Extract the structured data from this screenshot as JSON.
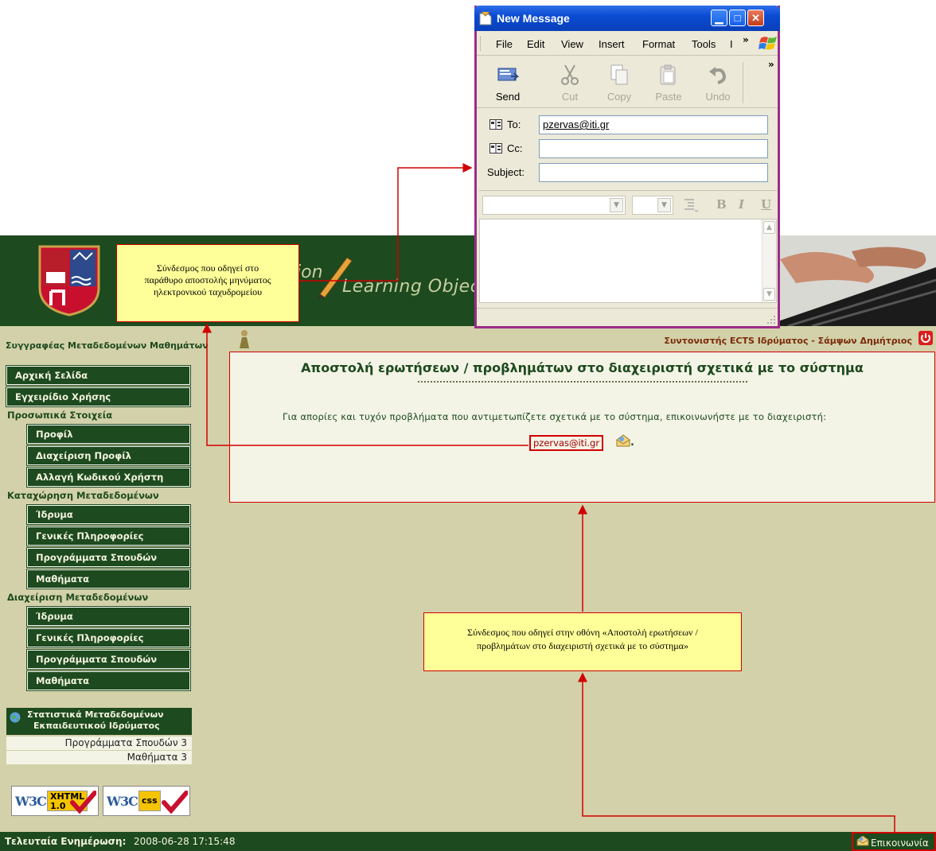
{
  "app": {
    "header_title_fragment": "ion",
    "header_subtitle": "Learning Objec",
    "author_role": "Συγγραφέας Μεταδεδομένων Μαθημάτων",
    "coordinator": "Συντονιστής ECTS Ιδρύματος - Σάμψων Δημήτριος"
  },
  "sidebar": {
    "home": "Αρχική Σελίδα",
    "manual": "Εγχειρίδιο Χρήσης",
    "personal_header": "Προσωπικά Στοιχεία",
    "profile": "Προφίλ",
    "profile_manage": "Διαχείριση Προφίλ",
    "change_password": "Αλλαγή Κωδικού Χρήστη",
    "registration_header": "Καταχώρηση Μεταδεδομένων",
    "reg_institution": "Ίδρυμα",
    "reg_general": "Γενικές Πληροφορίες",
    "reg_programs": "Προγράμματα Σπουδών",
    "reg_courses": "Μαθήματα",
    "management_header": "Διαχείριση Μεταδεδομένων",
    "man_institution": "Ίδρυμα",
    "man_general": "Γενικές Πληροφορίες",
    "man_programs": "Προγράμματα Σπουδών",
    "man_courses": "Μαθήματα"
  },
  "stats": {
    "title_line1": "Στατιστικά Μεταδεδομένων",
    "title_line2": "Εκπαιδευτικού Ιδρύματος",
    "rows": [
      "Προγράμματα Σπουδών 3",
      "Μαθήματα 3"
    ]
  },
  "badges": {
    "xhtml_w3c": "W3C",
    "xhtml_label": "XHTML",
    "xhtml_version": "1.0",
    "css_w3c": "W3C",
    "css_label": "css"
  },
  "content": {
    "title": "Αποστολή ερωτήσεων / προβλημάτων στο διαχειριστή σχετικά με το σύστημα",
    "text": "Για απορίες και τυχόν προβλήματα που αντιμετωπίζετε σχετικά με το σύστημα, επικοινωνήστε με το διαχειριστή:",
    "email": "pzervas@iti.gr",
    "period": "."
  },
  "footer": {
    "last_update_label": "Τελευταία Ενημέρωση:",
    "last_update_value": "2008-06-28 17:15:48",
    "contact": "Επικοινωνία"
  },
  "message_window": {
    "title": "New Message",
    "menu": [
      "File",
      "Edit",
      "View",
      "Insert",
      "Format",
      "Tools",
      "I"
    ],
    "menu_more": "»",
    "toolbar": [
      {
        "label": "Send",
        "icon": "send-icon",
        "enabled": true
      },
      {
        "label": "Cut",
        "icon": "cut-icon",
        "enabled": false
      },
      {
        "label": "Copy",
        "icon": "copy-icon",
        "enabled": false
      },
      {
        "label": "Paste",
        "icon": "paste-icon",
        "enabled": false
      },
      {
        "label": "Undo",
        "icon": "undo-icon",
        "enabled": false
      }
    ],
    "toolbar_more": "»",
    "to_label": "To:",
    "to_value": "pzervas@iti.gr",
    "cc_label": "Cc:",
    "cc_value": "",
    "subject_label": "Subject:",
    "subject_value": "",
    "format_bold": "B",
    "format_italic": "I",
    "format_underline": "U"
  },
  "annotations": {
    "email_callout_line1": "Σύνδεσμος που οδηγεί στο",
    "email_callout_line2": "παράθυρο αποστολής μηνύματος",
    "email_callout_line3": "ηλεκτρονικού ταχυδρομείου",
    "contact_callout_line1": "Σύνδεσμος που οδηγεί στην οθόνη «Αποστολή ερωτήσεων /",
    "contact_callout_line2": "προβλημάτων στο διαχειριστή σχετικά με το σύστημα»"
  },
  "colors": {
    "header_green": "#1d4a1e",
    "page_background": "#d3d1a9",
    "annotation_red": "#d10000",
    "callout_yellow": "#ffff99",
    "xp_titlebar_blue": "#0a4bd3"
  }
}
